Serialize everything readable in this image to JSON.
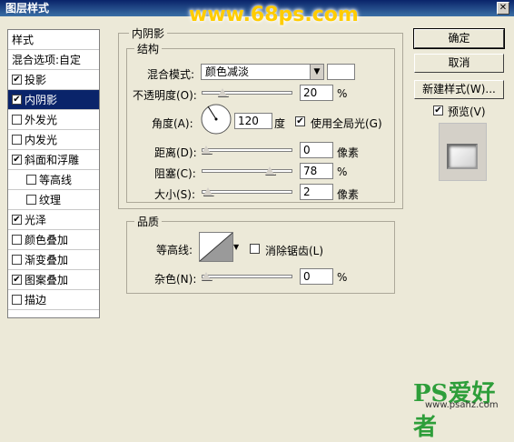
{
  "window": {
    "title": "图层样式",
    "close": "✕"
  },
  "watermark_top": "www.68ps.com",
  "left_list": {
    "header": "样式",
    "items": [
      {
        "label": "混合选项:自定",
        "checked": null
      },
      {
        "label": "投影",
        "checked": true
      },
      {
        "label": "内阴影",
        "checked": true,
        "selected": true
      },
      {
        "label": "外发光",
        "checked": false
      },
      {
        "label": "内发光",
        "checked": false
      },
      {
        "label": "斜面和浮雕",
        "checked": true
      },
      {
        "label": "等高线",
        "checked": false,
        "sub": true
      },
      {
        "label": "纹理",
        "checked": false,
        "sub": true
      },
      {
        "label": "光泽",
        "checked": true
      },
      {
        "label": "颜色叠加",
        "checked": false
      },
      {
        "label": "渐变叠加",
        "checked": false
      },
      {
        "label": "图案叠加",
        "checked": true
      },
      {
        "label": "描边",
        "checked": false
      }
    ]
  },
  "inner_shadow": {
    "section_title": "内阴影",
    "structure_title": "结构",
    "blend_mode_label": "混合模式:",
    "blend_mode_value": "颜色减淡",
    "opacity_label": "不透明度(O):",
    "opacity_value": "20",
    "opacity_level": 0.2,
    "percent": "%",
    "angle_label": "角度(A):",
    "angle_value": "120",
    "angle_unit": "度",
    "global_light_label": "使用全局光(G)",
    "global_light_checked": true,
    "distance_label": "距离(D):",
    "distance_value": "0",
    "distance_level": 0,
    "pixels": "像素",
    "choke_label": "阻塞(C):",
    "choke_value": "78",
    "choke_level": 0.78,
    "size_label": "大小(S):",
    "size_value": "2",
    "size_level": 0.02
  },
  "quality": {
    "title": "品质",
    "contour_label": "等高线:",
    "antialias_label": "消除锯齿(L)",
    "antialias_checked": false,
    "noise_label": "杂色(N):",
    "noise_value": "0",
    "noise_level": 0
  },
  "buttons": {
    "ok": "确定",
    "cancel": "取消",
    "new_style": "新建样式(W)...",
    "preview_label": "预览(V)",
    "preview_checked": true
  },
  "watermark_bottom": {
    "logo": "PS爱好者",
    "url": "www.psahz.com"
  }
}
